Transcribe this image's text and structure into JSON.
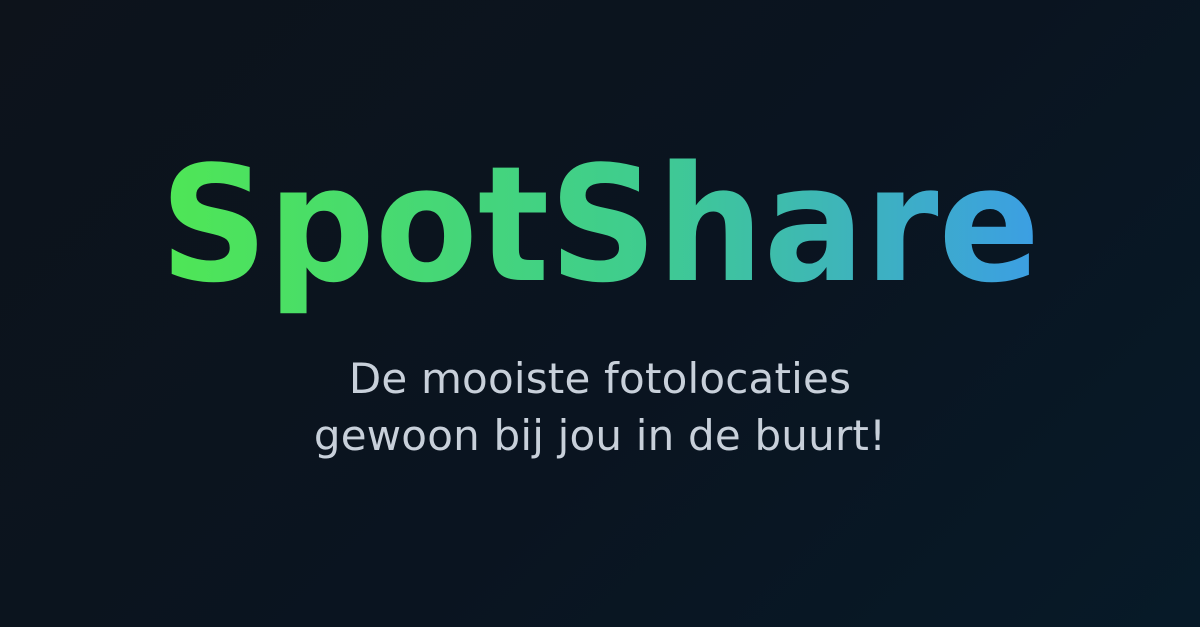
{
  "brand": {
    "name": "SpotShare",
    "gradient_start": "#4fe655",
    "gradient_mid": "#3fcc8f",
    "gradient_end": "#3c9ee4"
  },
  "tagline": {
    "line1": "De mooiste fotolocaties",
    "line2": "gewoon bij jou in de buurt!"
  },
  "colors": {
    "background": "#0b141d",
    "tagline_text": "#c8d0da"
  }
}
